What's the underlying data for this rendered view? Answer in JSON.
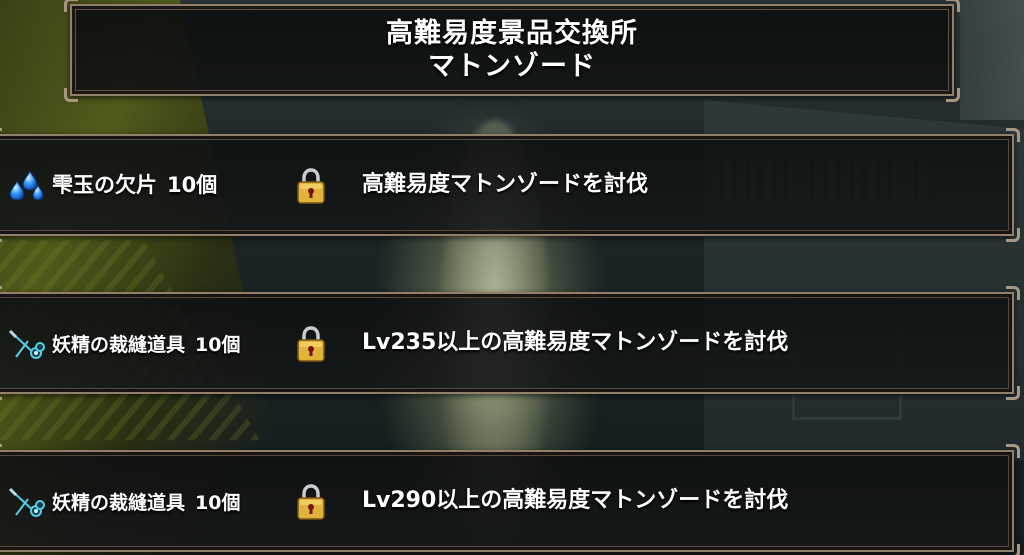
{
  "title": {
    "line1": "高難易度景品交換所",
    "line2": "マトンゾード"
  },
  "rewards": [
    {
      "item": "雫玉の欠片",
      "count": "10個",
      "icon": "water-drop-shards-icon",
      "locked": true,
      "condition": "高難易度マトンゾードを討伐"
    },
    {
      "item": "妖精の裁縫道具",
      "count": "10個",
      "icon": "fairy-sewing-kit-icon",
      "locked": true,
      "condition": "Lv235以上の高難易度マトンゾードを討伐"
    },
    {
      "item": "妖精の裁縫道具",
      "count": "10個",
      "icon": "fairy-sewing-kit-icon",
      "locked": true,
      "condition": "Lv290以上の高難易度マトンゾードを討伐"
    }
  ],
  "colors": {
    "frame": "#8f7f6b",
    "lock_gold": "#e0b43a",
    "drop_blue": "#3aa0ff",
    "tool_cyan": "#5fe0ff"
  }
}
